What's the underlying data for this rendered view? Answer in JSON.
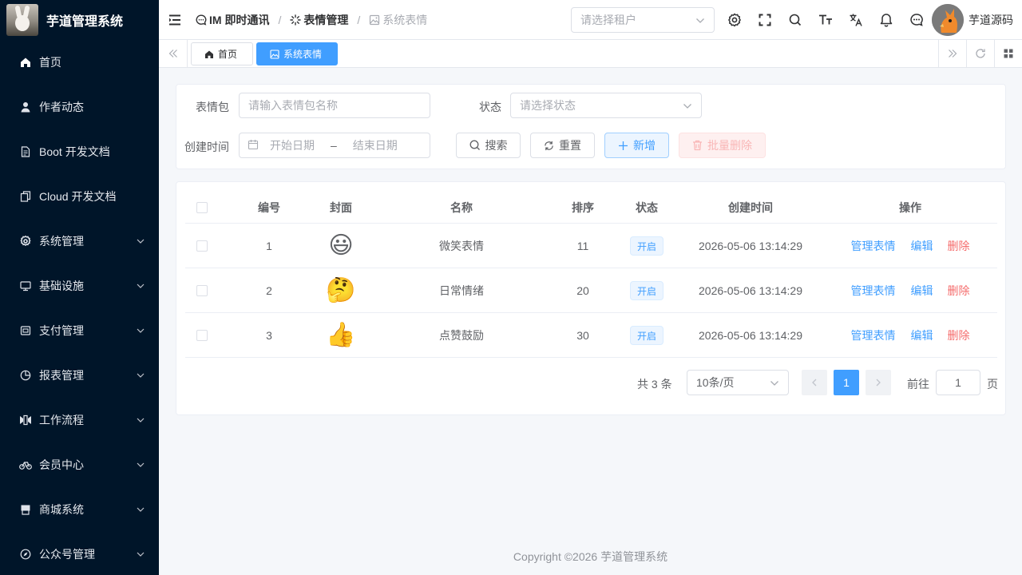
{
  "app": {
    "title": "芋道管理系统",
    "footer": "Copyright ©2026 芋道管理系统"
  },
  "sidebar": {
    "items": [
      {
        "label": "首页",
        "icon": "home-icon",
        "expandable": false
      },
      {
        "label": "作者动态",
        "icon": "user-icon",
        "expandable": false
      },
      {
        "label": "Boot 开发文档",
        "icon": "document-icon",
        "expandable": false
      },
      {
        "label": "Cloud 开发文档",
        "icon": "copy-document-icon",
        "expandable": false
      },
      {
        "label": "系统管理",
        "icon": "gear-icon",
        "expandable": true
      },
      {
        "label": "基础设施",
        "icon": "monitor-icon",
        "expandable": true
      },
      {
        "label": "支付管理",
        "icon": "wallet-icon",
        "expandable": true
      },
      {
        "label": "报表管理",
        "icon": "pie-chart-icon",
        "expandable": true
      },
      {
        "label": "工作流程",
        "icon": "flow-icon",
        "expandable": true
      },
      {
        "label": "会员中心",
        "icon": "bicycle-icon",
        "expandable": true
      },
      {
        "label": "商城系统",
        "icon": "shop-icon",
        "expandable": true
      },
      {
        "label": "公众号管理",
        "icon": "compass-icon",
        "expandable": true
      }
    ]
  },
  "header": {
    "breadcrumb": [
      {
        "label": "IM 即时通讯",
        "icon": "chat-bubble-icon"
      },
      {
        "label": "表情管理",
        "icon": "loading-icon"
      },
      {
        "label": "系统表情",
        "icon": "picture-icon"
      }
    ],
    "separator": "/",
    "tenant_placeholder": "请选择租户",
    "username": "芋道源码"
  },
  "tabs": {
    "items": [
      {
        "label": "首页",
        "icon": "home-icon",
        "active": false
      },
      {
        "label": "系统表情",
        "icon": "picture-icon",
        "active": true
      }
    ]
  },
  "search": {
    "pack_label": "表情包",
    "pack_placeholder": "请输入表情包名称",
    "status_label": "状态",
    "status_placeholder": "请选择状态",
    "time_label": "创建时间",
    "start_placeholder": "开始日期",
    "range_separator": "–",
    "end_placeholder": "结束日期",
    "search_button": "搜索",
    "reset_button": "重置",
    "add_button": "新增",
    "batch_delete_button": "批量删除"
  },
  "table": {
    "columns": [
      "编号",
      "封面",
      "名称",
      "排序",
      "状态",
      "创建时间",
      "操作"
    ],
    "rows": [
      {
        "id": "1",
        "cover": "😃",
        "name": "微笑表情",
        "sort": "11",
        "status": "开启",
        "created": "2026-05-06 13:14:29"
      },
      {
        "id": "2",
        "cover": "🤔",
        "name": "日常情绪",
        "sort": "20",
        "status": "开启",
        "created": "2026-05-06 13:14:29"
      },
      {
        "id": "3",
        "cover": "👍",
        "name": "点赞鼓励",
        "sort": "30",
        "status": "开启",
        "created": "2026-05-06 13:14:29"
      }
    ],
    "actions": {
      "manage": "管理表情",
      "edit": "编辑",
      "delete": "删除"
    }
  },
  "pagination": {
    "total": "共 3 条",
    "page_size": "10条/页",
    "current_page": "1",
    "goto_label": "前往",
    "goto_value": "1",
    "page_unit": "页"
  },
  "colors": {
    "sidebar_bg": "#001529",
    "primary": "#409eff",
    "danger": "#f56c6c"
  }
}
